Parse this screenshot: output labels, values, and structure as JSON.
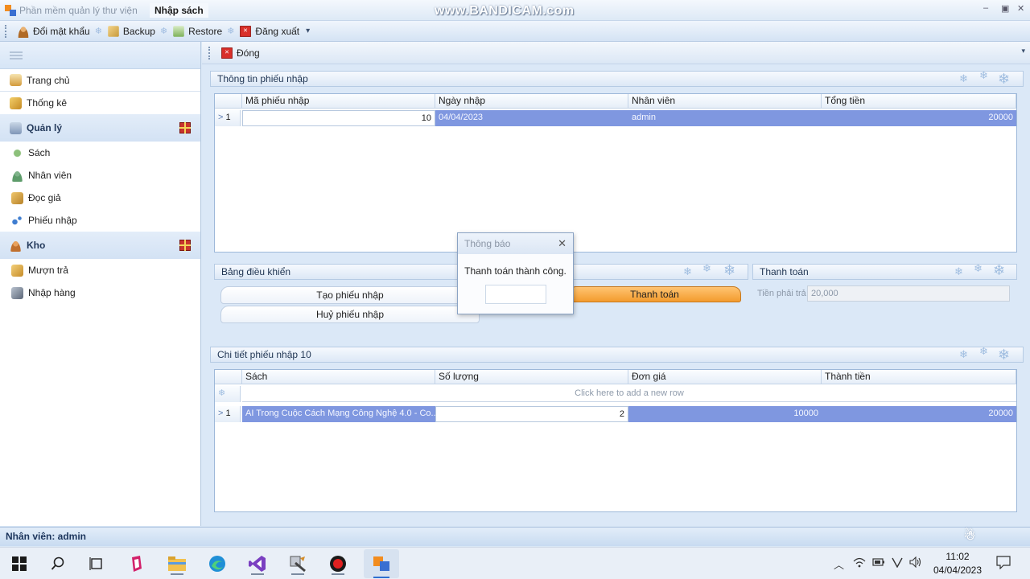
{
  "window": {
    "app_tab": "Phần mềm quản lý thư viện",
    "active_tab": "Nhập sách",
    "watermark": "www.BANDICAM.com",
    "min": "–",
    "restore": "▣",
    "close": "✕"
  },
  "toolbar": {
    "change_password": "Đổi mật khẩu",
    "backup": "Backup",
    "restore": "Restore",
    "logout": "Đăng xuất",
    "overflow": "▾"
  },
  "sidebar": {
    "home": "Trang chủ",
    "stats": "Thống kê",
    "group_manage": "Quản lý",
    "items_manage": [
      "Sách",
      "Nhân viên",
      "Đọc giả",
      "Phiếu nhập"
    ],
    "group_store": "Kho",
    "items_store": [
      "Mượn trả",
      "Nhập hàng"
    ]
  },
  "main": {
    "close_label": "Đóng",
    "receipt_panel": {
      "title": "Thông tin phiếu nhập",
      "columns": [
        "Mã phiếu nhập",
        "Ngày nhập",
        "Nhân viên",
        "Tổng tiền"
      ],
      "row": {
        "indicator": "1",
        "id": "10",
        "date": "04/04/2023",
        "employee": "admin",
        "total": "20000"
      }
    },
    "control_panel": {
      "title": "Bảng điều khiển",
      "create": "Tạo phiếu nhập",
      "cancel": "Huỷ phiếu nhập",
      "pay": "Thanh toán"
    },
    "payment_panel": {
      "title": "Thanh toán",
      "amount_label": "Tiền phải trả",
      "amount_value": "20,000"
    },
    "detail_panel": {
      "title": "Chi tiết phiếu nhập 10",
      "columns": [
        "Sách",
        "Số lượng",
        "Đơn giá",
        "Thành tiền"
      ],
      "new_row_hint": "Click here to add a new row",
      "row": {
        "indicator": "1",
        "book": "AI Trong Cuộc Cách Mạng Công Nghệ 4.0 - Co...",
        "qty": "2",
        "price": "10000",
        "amount": "20000"
      }
    }
  },
  "dialog": {
    "title": "Thông báo",
    "message": "Thanh toán thành công.",
    "close": "✕"
  },
  "status": {
    "user": "Nhân viên: admin"
  },
  "taskbar": {
    "time": "11:02",
    "date": "04/04/2023"
  },
  "colors": {
    "selection": "#7f97e0",
    "accent_orange": "#f39b2e"
  }
}
